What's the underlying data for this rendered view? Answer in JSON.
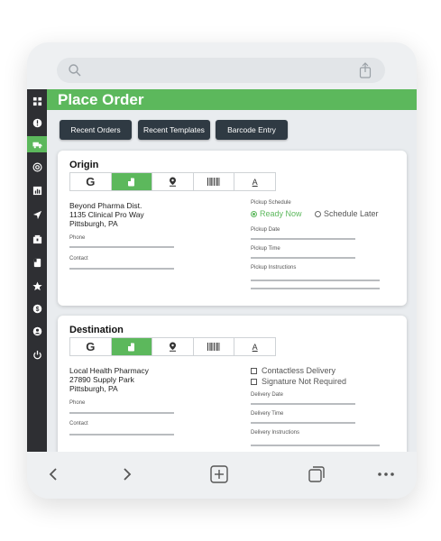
{
  "header": {
    "title": "Place Order"
  },
  "actions": [
    {
      "label": "Recent Orders"
    },
    {
      "label": "Recent Templates"
    },
    {
      "label": "Barcode Entry"
    }
  ],
  "sidebar": {
    "items": [
      {
        "icon": "grid-icon"
      },
      {
        "icon": "alert-icon"
      },
      {
        "icon": "truck-icon",
        "active": true
      },
      {
        "icon": "at-sign-icon"
      },
      {
        "icon": "chart-icon"
      },
      {
        "icon": "location-arrow-icon"
      },
      {
        "icon": "box-icon"
      },
      {
        "icon": "address-book-icon"
      },
      {
        "icon": "star-icon"
      },
      {
        "icon": "dollar-icon"
      },
      {
        "icon": "user-icon"
      },
      {
        "icon": "power-icon"
      }
    ]
  },
  "origin": {
    "title": "Origin",
    "tabs": [
      {
        "glyph": "G",
        "icon": "google-icon"
      },
      {
        "icon": "address-book-icon",
        "active": true
      },
      {
        "icon": "map-pin-icon"
      },
      {
        "icon": "barcode-icon"
      },
      {
        "glyph": "A",
        "icon": "font-icon"
      }
    ],
    "address": [
      "Beyond Pharma Dist.",
      "1135 Clinical Pro Way",
      "Pittsburgh, PA"
    ],
    "phone_label": "Phone",
    "contact_label": "Contact",
    "schedule_label": "Pickup Schedule",
    "ready_now": "Ready Now",
    "schedule_later": "Schedule Later",
    "date_label": "Pickup Date",
    "time_label": "Pickup Time",
    "instructions_label": "Pickup Instructions"
  },
  "destination": {
    "title": "Destination",
    "tabs": [
      {
        "glyph": "G",
        "icon": "google-icon"
      },
      {
        "icon": "address-book-icon",
        "active": true
      },
      {
        "icon": "map-pin-icon"
      },
      {
        "icon": "barcode-icon"
      },
      {
        "glyph": "A",
        "icon": "font-icon"
      }
    ],
    "address": [
      "Local Health Pharmacy",
      "27890 Supply Park",
      "Pittsburgh, PA"
    ],
    "phone_label": "Phone",
    "contact_label": "Contact",
    "contactless": "Contactless Delivery",
    "signature": "Signature Not Required",
    "date_label": "Delivery Date",
    "time_label": "Delivery Time",
    "instructions_label": "Delivery Instructions"
  },
  "browser_nav": [
    "back-icon",
    "forward-icon",
    "new-tab-icon",
    "tabs-icon",
    "more-icon"
  ],
  "colors": {
    "accent": "#5cb85c",
    "sidebar": "#2e2f33",
    "button": "#2f3a43"
  }
}
